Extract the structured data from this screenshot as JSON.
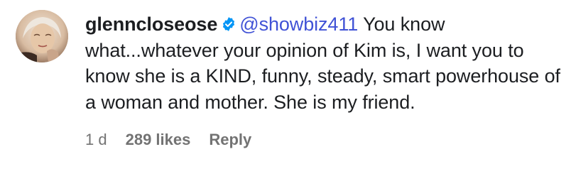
{
  "comment": {
    "username": "glenncloseose",
    "verified_icon": "verified-badge-icon",
    "mention": "@showbiz411",
    "body": " You know what...whatever your opinion of Kim is, I want you to know she is a KIND, funny, steady, smart powerhouse of a woman and mother. She is my friend.",
    "time": "1 d",
    "likes": "289 likes",
    "reply_label": "Reply"
  },
  "colors": {
    "mention": "#4052d6",
    "verified": "#0095f6",
    "meta": "#737373",
    "text": "#1c1e21"
  }
}
